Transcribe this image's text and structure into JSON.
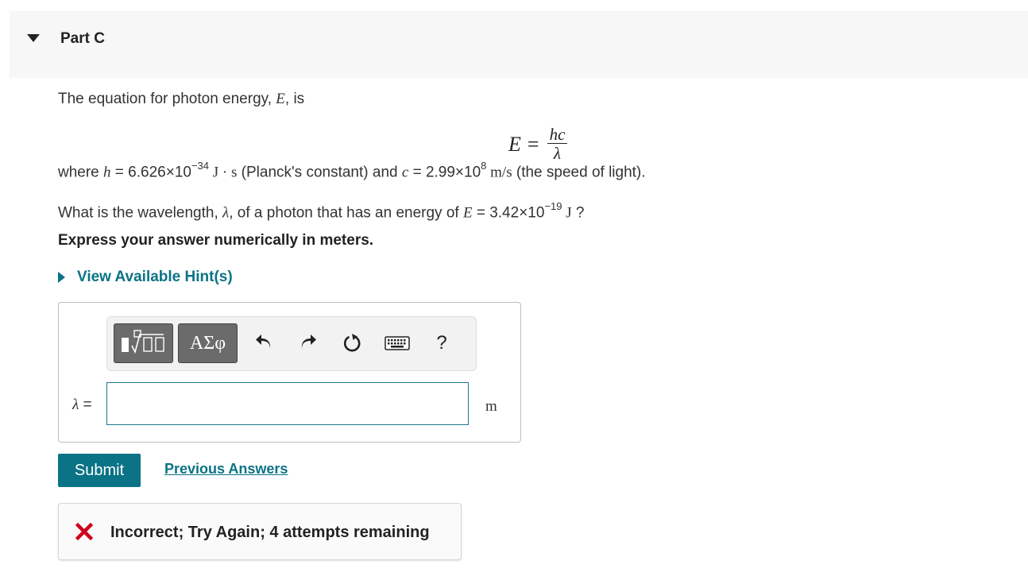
{
  "part": {
    "title": "Part C"
  },
  "intro": {
    "line1_prefix": "The equation for photon energy, ",
    "line1_var": "E",
    "line1_suffix": ", is"
  },
  "equation": {
    "lhs": "E",
    "equals": "=",
    "numerator": "hc",
    "denominator": "λ"
  },
  "constants": {
    "prefix": "where ",
    "h_var": "h",
    "h_value": " = 6.626×10",
    "h_exp": "−34",
    "h_unit": " J · s",
    "h_desc": " (Planck's constant) and ",
    "c_var": "c",
    "c_value": " = 2.99×10",
    "c_exp": "8",
    "c_unit": " m/s",
    "c_desc": " (the speed of light)."
  },
  "question": {
    "prefix": "What is the wavelength, ",
    "var": "λ",
    "middle": ", of a photon that has an energy of ",
    "e_var": "E",
    "e_value": " = 3.42×10",
    "e_exp": "−19",
    "e_unit": " J",
    "suffix": " ?"
  },
  "instruction": "Express your answer numerically in meters.",
  "hints": {
    "label": "View Available Hint(s)"
  },
  "answer": {
    "variable_label": "λ =",
    "value": "",
    "unit": "m",
    "toolbar": {
      "greek_label": "ΑΣφ",
      "help_label": "?"
    }
  },
  "actions": {
    "submit_label": "Submit",
    "previous_answers_label": "Previous Answers"
  },
  "feedback": {
    "message": "Incorrect; Try Again; 4 attempts remaining",
    "error_color": "#d0021b"
  },
  "colors": {
    "accent": "#0a7386",
    "header_bg": "#f7f7f7"
  }
}
